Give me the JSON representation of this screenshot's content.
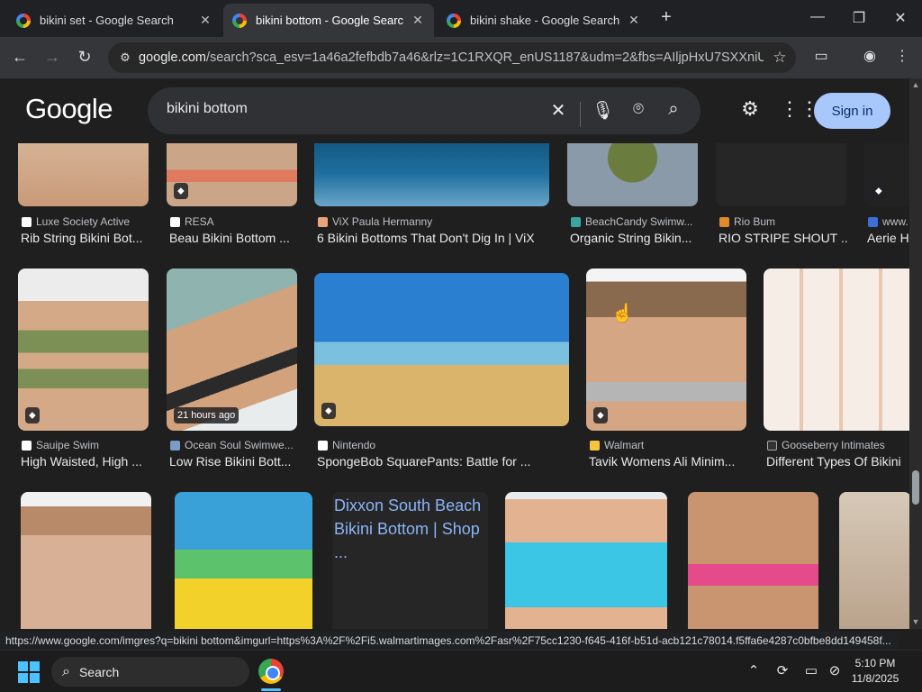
{
  "tabs": [
    {
      "title": "bikini set - Google Search"
    },
    {
      "title": "bikini bottom - Google Search"
    },
    {
      "title": "bikini shake - Google Search"
    }
  ],
  "omnibox": {
    "host": "google.com",
    "path": "/search?sca_esv=1a46a2fefbdb7a46&rlz=1C1RXQR_enUS1187&udm=2&fbs=AIljpHxU7SXXniUZf..."
  },
  "google": {
    "logo": "Google",
    "query": "bikini bottom",
    "signin_label": "Sign in"
  },
  "rows": [
    {
      "items": [
        {
          "source": "Luxe Society Active",
          "caption": "Rib String Bikini Bot..."
        },
        {
          "source": "RESA",
          "caption": "Beau Bikini Bottom ..."
        },
        {
          "source": "ViX Paula Hermanny",
          "caption": "6 Bikini Bottoms That Don't Dig In | ViX"
        },
        {
          "source": "BeachCandy Swimw...",
          "caption": "Organic String Bikin..."
        },
        {
          "source": "Rio Bum",
          "caption": "RIO STRIPE SHOUT ..."
        },
        {
          "source": "www.",
          "caption": "Aerie H"
        }
      ]
    },
    {
      "items": [
        {
          "source": "Sauipe Swim",
          "caption": "High Waisted, High ..."
        },
        {
          "source": "Ocean Soul Swimwe...",
          "caption": "Low Rise Bikini Bott...",
          "badge": "21 hours ago"
        },
        {
          "source": "Nintendo",
          "caption": "SpongeBob SquarePants: Battle for ..."
        },
        {
          "source": "Walmart",
          "caption": "Tavik Womens Ali Minim..."
        },
        {
          "source": "Gooseberry Intimates",
          "caption": "Different Types Of Bikini"
        }
      ]
    },
    {
      "items": [
        {
          "alt_text": "Dixxon South Beach Bikini Bottom | Shop ..."
        }
      ]
    }
  ],
  "status_url": "https://www.google.com/imgres?q=bikini bottom&imgurl=https%3A%2F%2Fi5.walmartimages.com%2Fasr%2F75cc1230-f645-416f-b51d-acb121c78014.f5ffa6e4287c0bfbe8dd149458f...",
  "taskbar": {
    "search_label": "Search",
    "time": "5:10 PM",
    "date": "11/8/2025"
  }
}
